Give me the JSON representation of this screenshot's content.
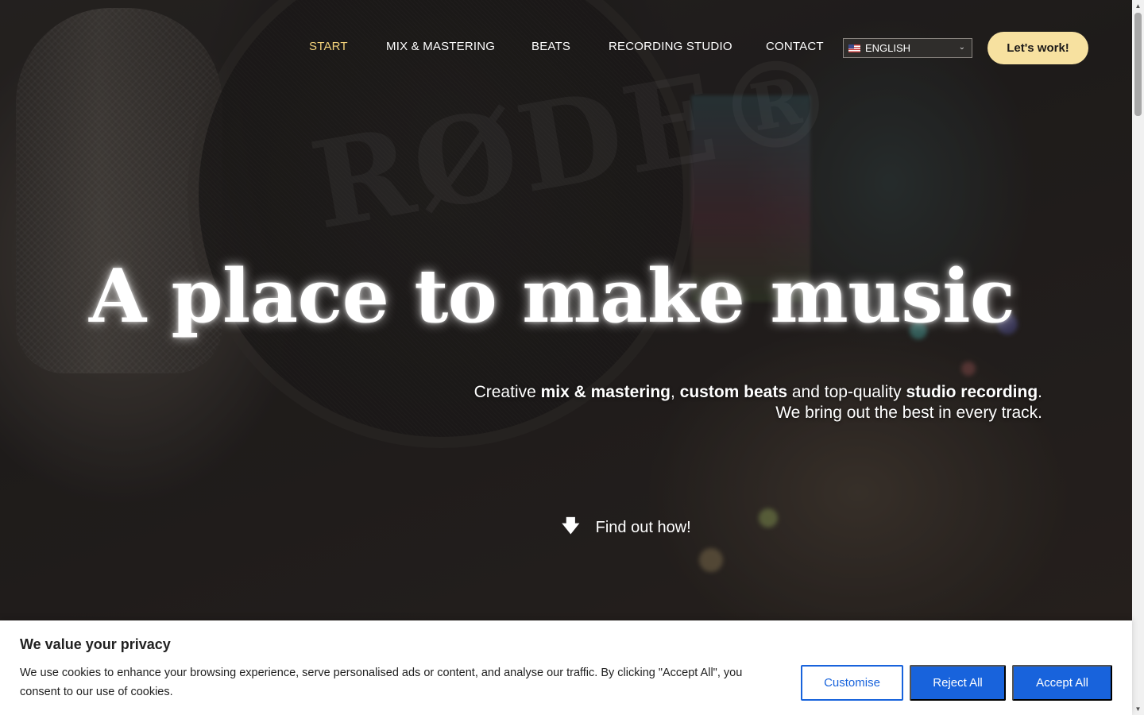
{
  "nav": {
    "items": [
      {
        "label": "START",
        "active": true
      },
      {
        "label": "MIX & MASTERING",
        "active": false
      },
      {
        "label": "BEATS",
        "active": false
      },
      {
        "label": "RECORDING STUDIO",
        "active": false
      },
      {
        "label": "CONTACT",
        "active": false
      }
    ],
    "language": {
      "flag_icon": "us-flag-icon",
      "selected": "ENGLISH"
    },
    "cta_label": "Let's work!",
    "active_color": "#f3d27a",
    "cta_color": "#f7e1a0"
  },
  "hero": {
    "headline": "A place to make music",
    "subline": {
      "line1": {
        "t1": "Creative ",
        "b1": "mix & mastering",
        "t2": ", ",
        "b2": "custom beats",
        "t3": " and top-quality ",
        "b3": "studio recording",
        "t4": "."
      },
      "line2": "We bring out the best in every track."
    },
    "scroll_cta": {
      "icon": "arrow-down-icon",
      "label": "Find out how!"
    },
    "background_mark": "RØDE®"
  },
  "cookie_banner": {
    "title": "We value your privacy",
    "text": "We use cookies to enhance your browsing experience, serve personalised ads or content, and analyse our traffic. By clicking \"Accept All\", you consent to our use of cookies.",
    "buttons": {
      "customise": "Customise",
      "reject": "Reject All",
      "accept": "Accept All"
    },
    "accent_color": "#1863dc"
  }
}
